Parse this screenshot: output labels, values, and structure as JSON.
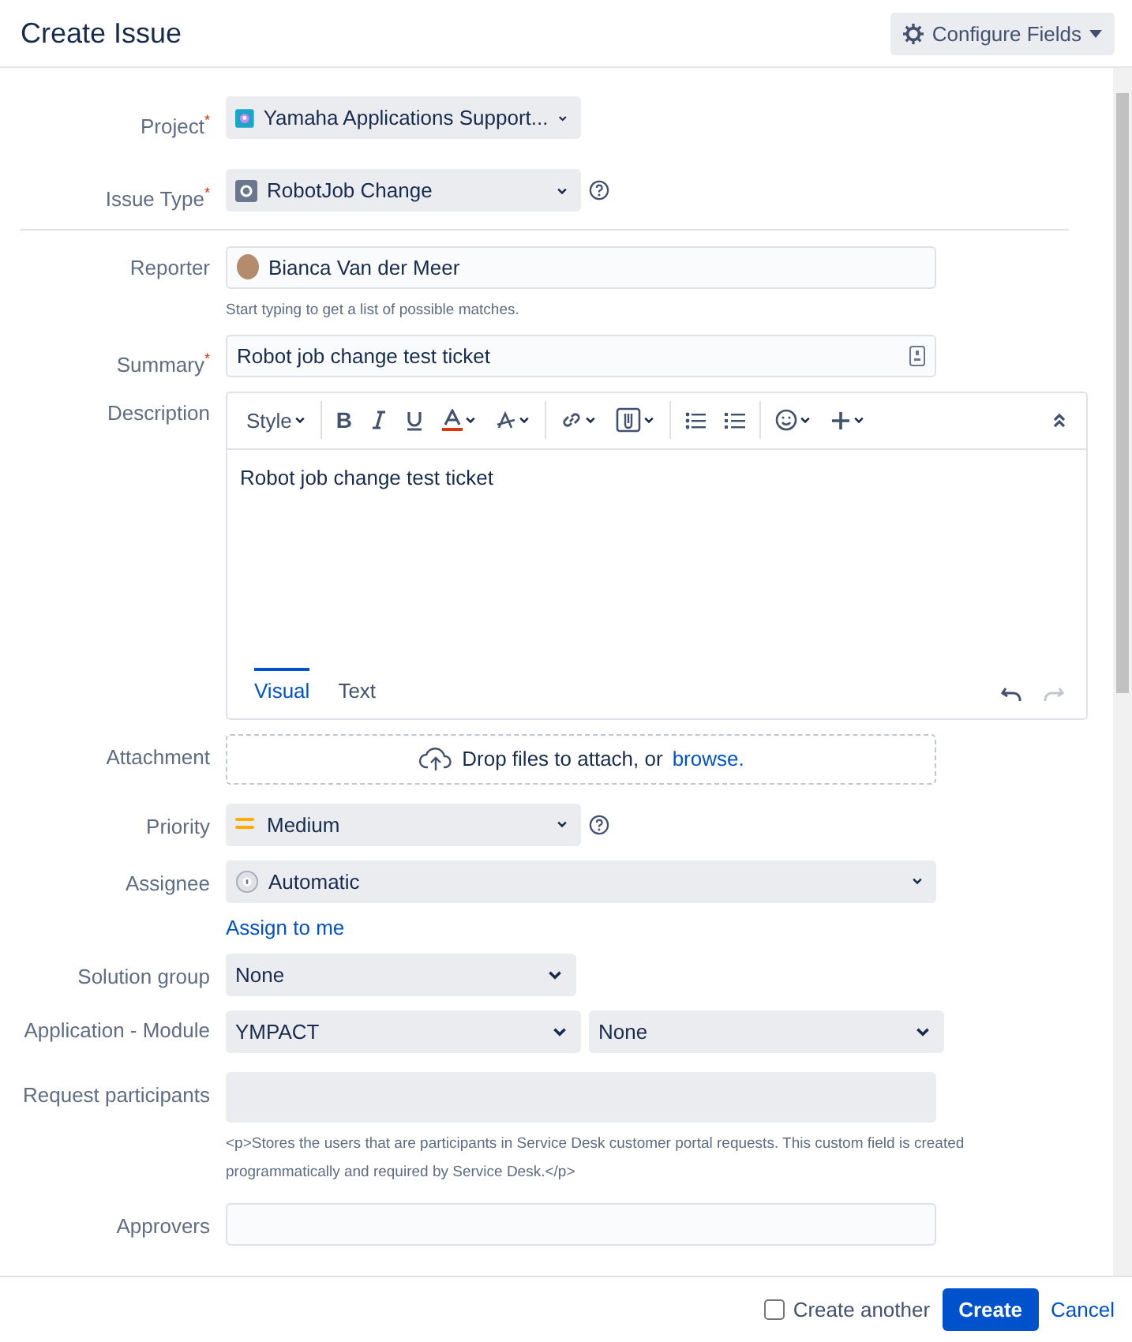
{
  "header": {
    "title": "Create Issue",
    "configure_button": "Configure Fields"
  },
  "top_fields": [
    {
      "kind": "project-select",
      "label": "Project",
      "required_mark": "*",
      "value": "Yamaha Applications Support...",
      "help": false
    },
    {
      "kind": "issue-type-select",
      "label": "Issue Type",
      "required_mark": "*",
      "value": "RobotJob Change",
      "help": true
    }
  ],
  "fields": [
    {
      "kind": "user",
      "label": "Reporter",
      "value": "Bianca Van der Meer",
      "hint": "Start typing to get a list of possible matches."
    },
    {
      "kind": "text",
      "label": "Summary",
      "required_mark": "*",
      "value": "Robot job change test ticket"
    },
    {
      "kind": "editor",
      "label": "Description",
      "style_menu": "Style",
      "bold_button": "B",
      "value": "Robot job change test ticket",
      "tabs": [
        {
          "label": "Visual",
          "selected": true
        },
        {
          "label": "Text",
          "selected": false
        }
      ]
    },
    {
      "kind": "attachment",
      "label": "Attachment",
      "text": "Drop files to attach, or",
      "link": "browse."
    },
    {
      "kind": "priority-select",
      "label": "Priority",
      "value": "Medium",
      "help": true
    },
    {
      "kind": "assignee-select",
      "label": "Assignee",
      "value": "Automatic",
      "link": "Assign to me"
    },
    {
      "kind": "plain-select",
      "label": "Solution group",
      "value": "None"
    },
    {
      "kind": "dual-select",
      "label": "Application - Module",
      "value": "YMPACT",
      "value_2": "None"
    },
    {
      "kind": "empty",
      "label": "Request participants",
      "hint": "<p>Stores the users that are participants in Service Desk customer portal requests. This custom field is created programmatically and required by Service Desk.</p>"
    },
    {
      "kind": "empty-text",
      "label": "Approvers"
    }
  ],
  "footer": {
    "create_another": {
      "label": "Create another",
      "checked": false
    },
    "create_button": "Create",
    "cancel_link": "Cancel"
  }
}
